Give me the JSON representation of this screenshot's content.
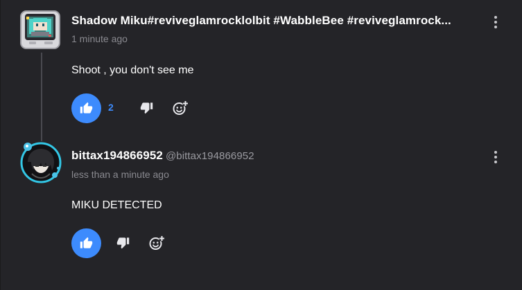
{
  "comments": [
    {
      "username": "Shadow Miku#reviveglamrocklolbit #WabbleBee #reviveglamrock...",
      "handle": "",
      "timestamp": "1 minute ago",
      "body": "Shoot , you don't see me",
      "like_count": "2",
      "avatar_icon": "tv-miku-avatar-icon"
    },
    {
      "username": "bittax194866952",
      "handle": "@bittax194866952",
      "timestamp": "less than a minute ago",
      "body": "MIKU DETECTED",
      "like_count": "",
      "avatar_icon": "anime-character-avatar-icon"
    }
  ],
  "colors": {
    "background": "#242428",
    "accent": "#3d8bfd",
    "muted_text": "#8a8a90",
    "thread_line": "#4a4a50"
  },
  "icons": {
    "like": "thumbs-up-icon",
    "dislike": "thumbs-down-icon",
    "react": "add-reaction-icon",
    "more": "more-options-icon"
  }
}
